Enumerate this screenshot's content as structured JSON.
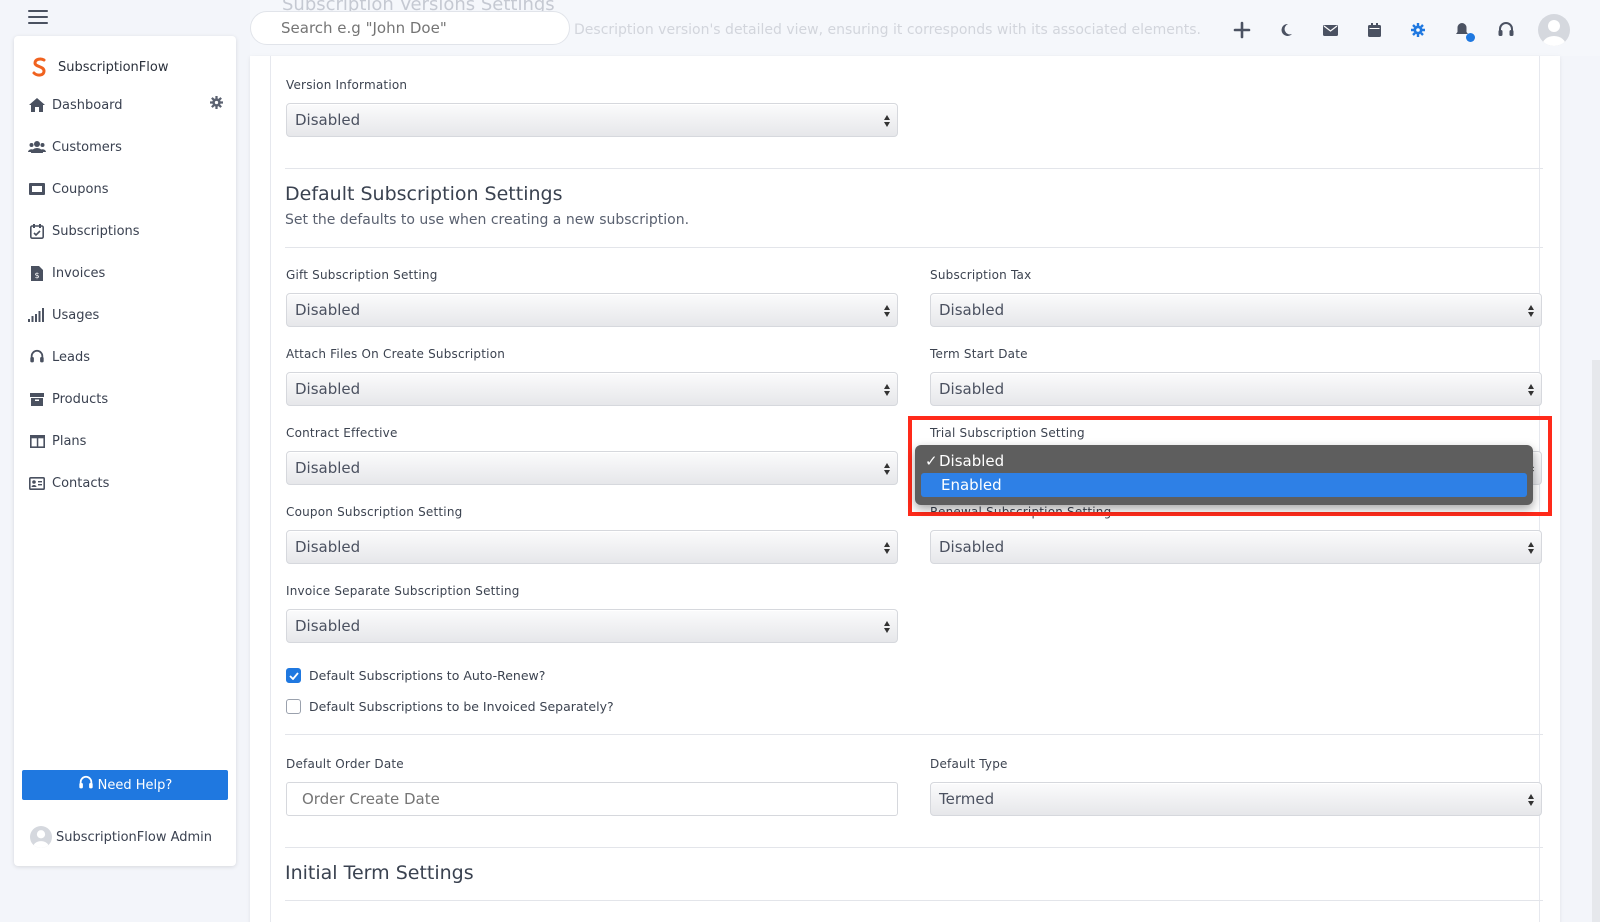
{
  "app": {
    "brand": "SubscriptionFlow"
  },
  "search": {
    "placeholder": "Search e.g \"John Doe\""
  },
  "ghost": {
    "title": "Subscription Versions Settings",
    "subtitle": "Description version's detailed view, ensuring it corresponds with its associated elements."
  },
  "sidebar": {
    "items": [
      {
        "label": "Dashboard",
        "icon": "home-icon"
      },
      {
        "label": "Customers",
        "icon": "users-icon"
      },
      {
        "label": "Coupons",
        "icon": "ticket-icon"
      },
      {
        "label": "Subscriptions",
        "icon": "calendar-check-icon"
      },
      {
        "label": "Invoices",
        "icon": "invoice-icon"
      },
      {
        "label": "Usages",
        "icon": "bars-icon"
      },
      {
        "label": "Leads",
        "icon": "headset-icon"
      },
      {
        "label": "Products",
        "icon": "box-icon"
      },
      {
        "label": "Plans",
        "icon": "columns-icon"
      },
      {
        "label": "Contacts",
        "icon": "contact-card-icon"
      }
    ],
    "help_label": "Need Help?",
    "admin_name": "SubscriptionFlow Admin"
  },
  "form": {
    "version_info": {
      "label": "Version Information",
      "value": "Disabled"
    },
    "default_section": {
      "title": "Default Subscription Settings",
      "subtitle": "Set the defaults to use when creating a new subscription."
    },
    "gift": {
      "label": "Gift Subscription Setting",
      "value": "Disabled"
    },
    "tax": {
      "label": "Subscription Tax",
      "value": "Disabled"
    },
    "attach": {
      "label": "Attach Files On Create Subscription",
      "value": "Disabled"
    },
    "term_start": {
      "label": "Term Start Date",
      "value": "Disabled"
    },
    "contract": {
      "label": "Contract Effective",
      "value": "Disabled"
    },
    "trial": {
      "label": "Trial Subscription Setting",
      "options": [
        "Disabled",
        "Enabled"
      ],
      "checkmark": "✓"
    },
    "coupon": {
      "label": "Coupon Subscription Setting",
      "value": "Disabled"
    },
    "renewal": {
      "label": "Renewal Subscription Setting",
      "value": "Disabled"
    },
    "invoice_sep": {
      "label": "Invoice Separate Subscription Setting",
      "value": "Disabled"
    },
    "auto_renew": {
      "label": "Default Subscriptions to Auto-Renew?",
      "checked": true
    },
    "invoiced_sep": {
      "label": "Default Subscriptions to be Invoiced Separately?",
      "checked": false
    },
    "order_date": {
      "label": "Default Order Date",
      "placeholder": "Order Create Date"
    },
    "default_type": {
      "label": "Default Type",
      "value": "Termed"
    },
    "initial_term": {
      "title": "Initial Term Settings"
    }
  },
  "colors": {
    "accent": "#1f78e0",
    "highlight": "#ff2a1a"
  }
}
